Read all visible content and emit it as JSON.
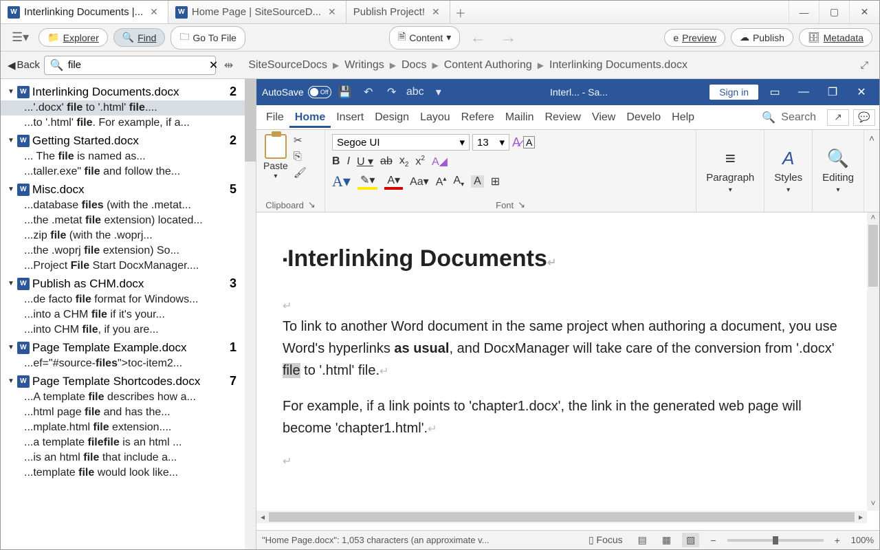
{
  "tabs": [
    {
      "title": "Interlinking Documents |...",
      "active": true,
      "icon": "W"
    },
    {
      "title": "Home Page | SiteSourceD...",
      "active": false,
      "icon": "W"
    },
    {
      "title": "Publish Project!",
      "active": false,
      "icon": ""
    }
  ],
  "toolbar": {
    "explorer": "Explorer",
    "find": "Find",
    "goto": "Go To File",
    "content": "Content",
    "preview": "Preview",
    "publish": "Publish",
    "metadata": "Metadata"
  },
  "back": "Back",
  "search_value": "file",
  "breadcrumb": [
    "SiteSourceDocs",
    "Writings",
    "Docs",
    "Content Authoring",
    "Interlinking Documents.docx"
  ],
  "results": [
    {
      "file": "Interlinking Documents.docx",
      "count": "2",
      "lines": [
        {
          "pre": "...'.docx' ",
          "m1": "file",
          "mid": " to '.html' ",
          "m2": "file",
          "post": "....",
          "sel": true
        },
        {
          "pre": "...to '.html' ",
          "m1": "file",
          "post": ". For example, if a..."
        }
      ]
    },
    {
      "file": "Getting Started.docx",
      "count": "2",
      "lines": [
        {
          "pre": "...  The ",
          "m1": "file",
          "post": " is named as..."
        },
        {
          "pre": "...taller.exe\" ",
          "m1": "file",
          "post": " and follow the..."
        }
      ]
    },
    {
      "file": "Misc.docx",
      "count": "5",
      "lines": [
        {
          "pre": "...database ",
          "m1": "files",
          "post": " (with the .metat..."
        },
        {
          "pre": "...the .metat ",
          "m1": "file",
          "post": " extension) located..."
        },
        {
          "pre": "...zip ",
          "m1": "file",
          "post": " (with the .woprj..."
        },
        {
          "pre": "...the .woprj ",
          "m1": "file",
          "post": " extension) So..."
        },
        {
          "pre": "...Project ",
          "m1": "File",
          "post": " Start DocxManager...."
        }
      ]
    },
    {
      "file": "Publish as CHM.docx",
      "count": "3",
      "lines": [
        {
          "pre": "...de facto ",
          "m1": "file",
          "post": " format for Windows..."
        },
        {
          "pre": "...into a CHM ",
          "m1": "file",
          "post": " if it's your..."
        },
        {
          "pre": "...into CHM ",
          "m1": "file",
          "post": ", if you are..."
        }
      ]
    },
    {
      "file": "Page Template Example.docx",
      "count": "1",
      "lines": [
        {
          "pre": "...ef=\"#source-",
          "m1": "files",
          "post": "\">toc-item2..."
        }
      ]
    },
    {
      "file": "Page Template Shortcodes.docx",
      "count": "7",
      "lines": [
        {
          "pre": "...A template ",
          "m1": "file",
          "post": " describes how a..."
        },
        {
          "pre": "...html page ",
          "m1": "file",
          "post": " and has the..."
        },
        {
          "pre": "...mplate.html ",
          "m1": "file",
          "post": " extension...."
        },
        {
          "pre": "...a template ",
          "m1": "file",
          "post": " is an html ",
          "m2": "file",
          "post2": "..."
        },
        {
          "pre": "...is an html ",
          "m1": "file",
          "post": " that include a..."
        },
        {
          "pre": "...template ",
          "m1": "file",
          "post": " would look like..."
        }
      ]
    }
  ],
  "word": {
    "autosave": "AutoSave",
    "off": "Off",
    "title": "Interl...  -  Sa...",
    "signin": "Sign in",
    "tabs": [
      "File",
      "Home",
      "Insert",
      "Design",
      "Layou",
      "Refere",
      "Mailin",
      "Review",
      "View",
      "Develo",
      "Help"
    ],
    "active_tab": "Home",
    "search": "Search",
    "font_name": "Segoe UI",
    "font_size": "13",
    "groups": {
      "clipboard": "Clipboard",
      "font": "Font",
      "paragraph": "Paragraph",
      "styles": "Styles",
      "editing": "Editing",
      "paste": "Paste"
    }
  },
  "doc": {
    "h1": "Interlinking Documents",
    "p1a": "To link to another Word document in the same project when authoring a document, you use Word's hyperlinks ",
    "p1b": "as usual",
    "p1c": ", and DocxManager will take care of the conversion from '.docx' ",
    "p1hl": "file",
    "p1d": " to '.html' file.",
    "p2": "For example, if a link points to 'chapter1.docx', the link in the generated web page will become 'chapter1.html'."
  },
  "status": {
    "text": "\"Home Page.docx\": 1,053 characters (an approximate v...",
    "focus": "Focus",
    "zoom": "100%"
  }
}
